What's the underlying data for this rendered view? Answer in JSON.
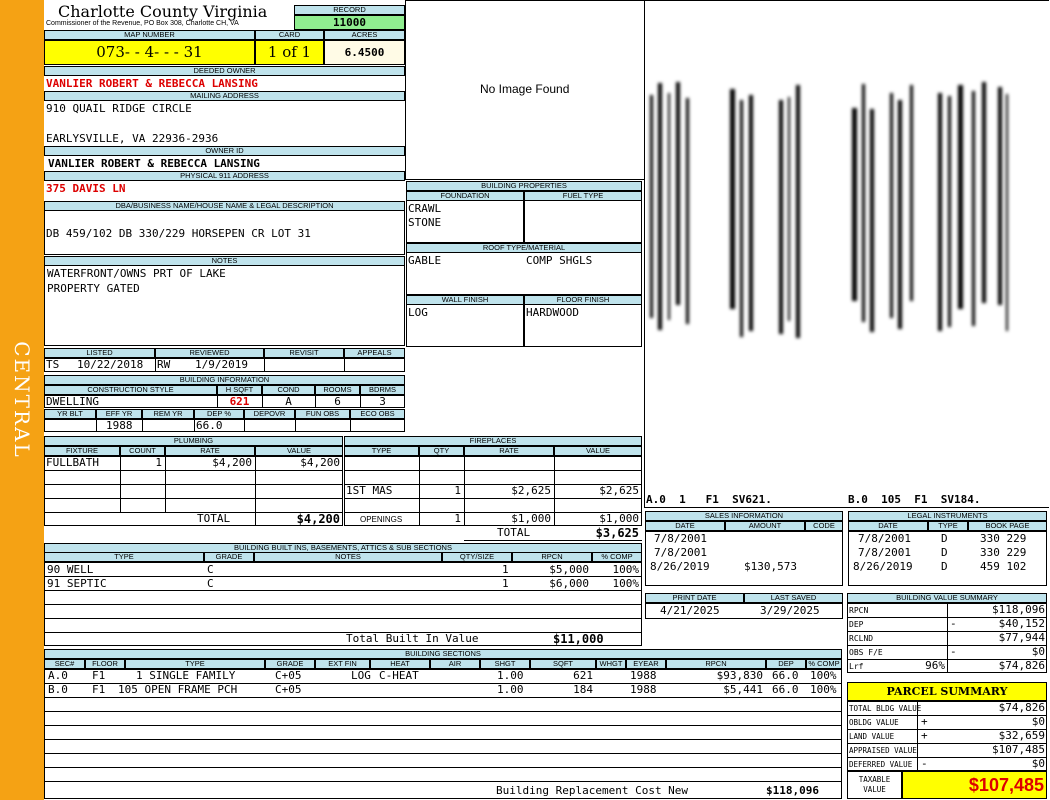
{
  "sidebar": {
    "district": "CENTRAL"
  },
  "header": {
    "county": "Charlotte County Virginia",
    "commissioner": "Commissioner of the Revenue, PO Box 308, Charlotte CH, VA",
    "record_label": "RECORD",
    "record": "11000",
    "map_label": "MAP NUMBER",
    "map": "073- - 4- - - 31",
    "card_label": "CARD",
    "card": "1 of 1",
    "acres_label": "ACRES",
    "acres": "6.4500"
  },
  "owner": {
    "deeded_label": "DEEDED OWNER",
    "deeded": "VANLIER ROBERT & REBECCA LANSING",
    "mailing_label": "MAILING ADDRESS",
    "mail1": "910 QUAIL RIDGE CIRCLE",
    "mail2": "EARLYSVILLE, VA 22936-2936",
    "ownerid_label": "OWNER ID",
    "ownerid": "VANLIER ROBERT & REBECCA LANSING",
    "phys_label": "PHYSICAL 911 ADDRESS",
    "phys": "375 DAVIS LN",
    "dba_label": "DBA/BUSINESS NAME/HOUSE NAME & LEGAL DESCRIPTION",
    "dba": "DB 459/102 DB 330/229 HORSEPEN CR LOT 31",
    "notes_label": "NOTES",
    "notes1": "WATERFRONT/OWNS PRT OF LAKE",
    "notes2": "PROPERTY GATED"
  },
  "image": {
    "placeholder": "No Image Found"
  },
  "building_props": {
    "title": "BUILDING PROPERTIES",
    "foundation_label": "FOUNDATION",
    "fuel_label": "FUEL TYPE",
    "foundation1": "CRAWL",
    "foundation2": "STONE",
    "roof_label": "ROOF TYPE/MATERIAL",
    "roof1": "GABLE",
    "roof2": "COMP SHGLS",
    "wall_label": "WALL FINISH",
    "floor_label": "FLOOR FINISH",
    "wall": "LOG",
    "floor": "HARDWOOD"
  },
  "sketch": {
    "caption_a": "A.0  1   F1  SV621.",
    "caption_b": "B.0  105  F1  SV184."
  },
  "review": {
    "listed_label": "LISTED",
    "reviewed_label": "REVIEWED",
    "revisit_label": "REVISIT",
    "appeals_label": "APPEALS",
    "listed_by": "TS",
    "listed_date": "10/22/2018",
    "reviewed_by": "RW",
    "reviewed_date": "1/9/2019"
  },
  "bldg_info": {
    "title": "BUILDING INFORMATION",
    "style_label": "CONSTRUCTION STYLE",
    "hsqft_label": "H SQFT",
    "cond_label": "COND",
    "rooms_label": "ROOMS",
    "bdrms_label": "BDRMS",
    "style": "DWELLING",
    "hsqft": "621",
    "cond": "A",
    "rooms": "6",
    "bdrms": "3",
    "yrblt_label": "YR BLT",
    "effyr_label": "EFF YR",
    "remyr_label": "REM YR",
    "dep_label": "DEP %",
    "depovr_label": "DEPOVR",
    "funobs_label": "FUN OBS",
    "ecoobs_label": "ECO OBS",
    "effyr": "1988",
    "dep": "66.0"
  },
  "plumbing": {
    "title": "PLUMBING",
    "fixture_label": "FIXTURE",
    "count_label": "COUNT",
    "rate_label": "RATE",
    "value_label": "VALUE",
    "fixture": "FULLBATH",
    "count": "1",
    "rate": "$4,200",
    "value": "$4,200",
    "total_label": "TOTAL",
    "total": "$4,200"
  },
  "fireplaces": {
    "title": "FIREPLACES",
    "type_label": "TYPE",
    "qty_label": "QTY",
    "rate_label": "RATE",
    "value_label": "VALUE",
    "type": "1ST MAS",
    "qty": "1",
    "rate": "$2,625",
    "value": "$2,625",
    "open_label": "OPENINGS",
    "open_qty": "1",
    "open_rate": "$1,000",
    "open_value": "$1,000",
    "total_label": "TOTAL",
    "total": "$3,625"
  },
  "sales": {
    "title": "SALES INFORMATION",
    "date_label": "DATE",
    "amount_label": "AMOUNT",
    "code_label": "CODE",
    "rows": [
      {
        "date": "7/8/2001",
        "amount": ""
      },
      {
        "date": "7/8/2001",
        "amount": ""
      },
      {
        "date": "8/26/2019",
        "amount": "$130,573"
      }
    ]
  },
  "legal": {
    "title": "LEGAL INSTRUMENTS",
    "date_label": "DATE",
    "type_label": "TYPE",
    "book_label": "BOOK PAGE",
    "rows": [
      {
        "date": "7/8/2001",
        "type": "D",
        "book": "330 229"
      },
      {
        "date": "7/8/2001",
        "type": "D",
        "book": "330 229"
      },
      {
        "date": "8/26/2019",
        "type": "D",
        "book": "459 102"
      }
    ]
  },
  "builtins": {
    "title": "BUILDING BUILT INS, BASEMENTS, ATTICS & SUB SECTIONS",
    "type_label": "TYPE",
    "grade_label": "GRADE",
    "notes_label": "NOTES",
    "qty_label": "QTY/SIZE",
    "rpcn_label": "RPCN",
    "comp_label": "% COMP",
    "rows": [
      {
        "type": "90 WELL",
        "grade": "C",
        "qty": "1",
        "rpcn": "$5,000",
        "comp": "100%"
      },
      {
        "type": "91 SEPTIC",
        "grade": "C",
        "qty": "1",
        "rpcn": "$6,000",
        "comp": "100%"
      }
    ],
    "total_label": "Total Built In Value",
    "total": "$11,000"
  },
  "print": {
    "print_label": "PRINT DATE",
    "saved_label": "LAST SAVED",
    "print": "4/21/2025",
    "saved": "3/29/2025"
  },
  "bvs": {
    "title": "BUILDING VALUE SUMMARY",
    "rpcn_label": "RPCN",
    "rpcn": "$118,096",
    "dep_label": "DEP",
    "dep_sign": "-",
    "dep": "$40,152",
    "rclnd_label": "RCLND",
    "rclnd": "$77,944",
    "obs_label": "OBS F/E",
    "obs_sign": "-",
    "obs": "$0",
    "lrf_label": "Lrf",
    "lrf_pct": "96%",
    "lrf": "$74,826"
  },
  "sections": {
    "title": "BUILDING SECTIONS",
    "h_sec": "SEC#",
    "h_floor": "FLOOR",
    "h_type": "TYPE",
    "h_grade": "GRADE",
    "h_ext": "EXT FIN",
    "h_heat": "HEAT",
    "h_air": "AIR",
    "h_shgt": "SHGT",
    "h_sqft": "SQFT",
    "h_whgt": "WHGT",
    "h_eyear": "EYEAR",
    "h_rpcn": "RPCN",
    "h_dep": "DEP",
    "h_comp": "% COMP",
    "rows": [
      {
        "sec": "A.0",
        "floor": "F1",
        "type": "1 SINGLE FAMILY",
        "grade": "C+05",
        "ext": "LOG",
        "heat": "C-HEAT",
        "air": "",
        "shgt": "1.00",
        "sqft": "621",
        "whgt": "",
        "eyear": "1988",
        "rpcn": "$93,830",
        "dep": "66.0",
        "comp": "100%"
      },
      {
        "sec": "B.0",
        "floor": "F1",
        "type": "105 OPEN FRAME PCH",
        "grade": "C+05",
        "ext": "",
        "heat": "",
        "air": "",
        "shgt": "1.00",
        "sqft": "184",
        "whgt": "",
        "eyear": "1988",
        "rpcn": "$5,441",
        "dep": "66.0",
        "comp": "100%"
      }
    ],
    "brcn_label": "Building Replacement Cost New",
    "brcn": "$118,096"
  },
  "parcel": {
    "title": "PARCEL SUMMARY",
    "tbv_label": "TOTAL BLDG VALUE",
    "tbv": "$74,826",
    "obldg_label": "OBLDG VALUE",
    "obldg_sign": "+",
    "obldg": "$0",
    "land_label": "LAND VALUE",
    "land_sign": "+",
    "land": "$32,659",
    "appr_label": "APPRAISED VALUE",
    "appr": "$107,485",
    "def_label": "DEFERRED VALUE",
    "def_sign": "-",
    "def": "$0",
    "taxable_label1": "TAXABLE",
    "taxable_label2": "VALUE",
    "taxable": "$107,485"
  }
}
